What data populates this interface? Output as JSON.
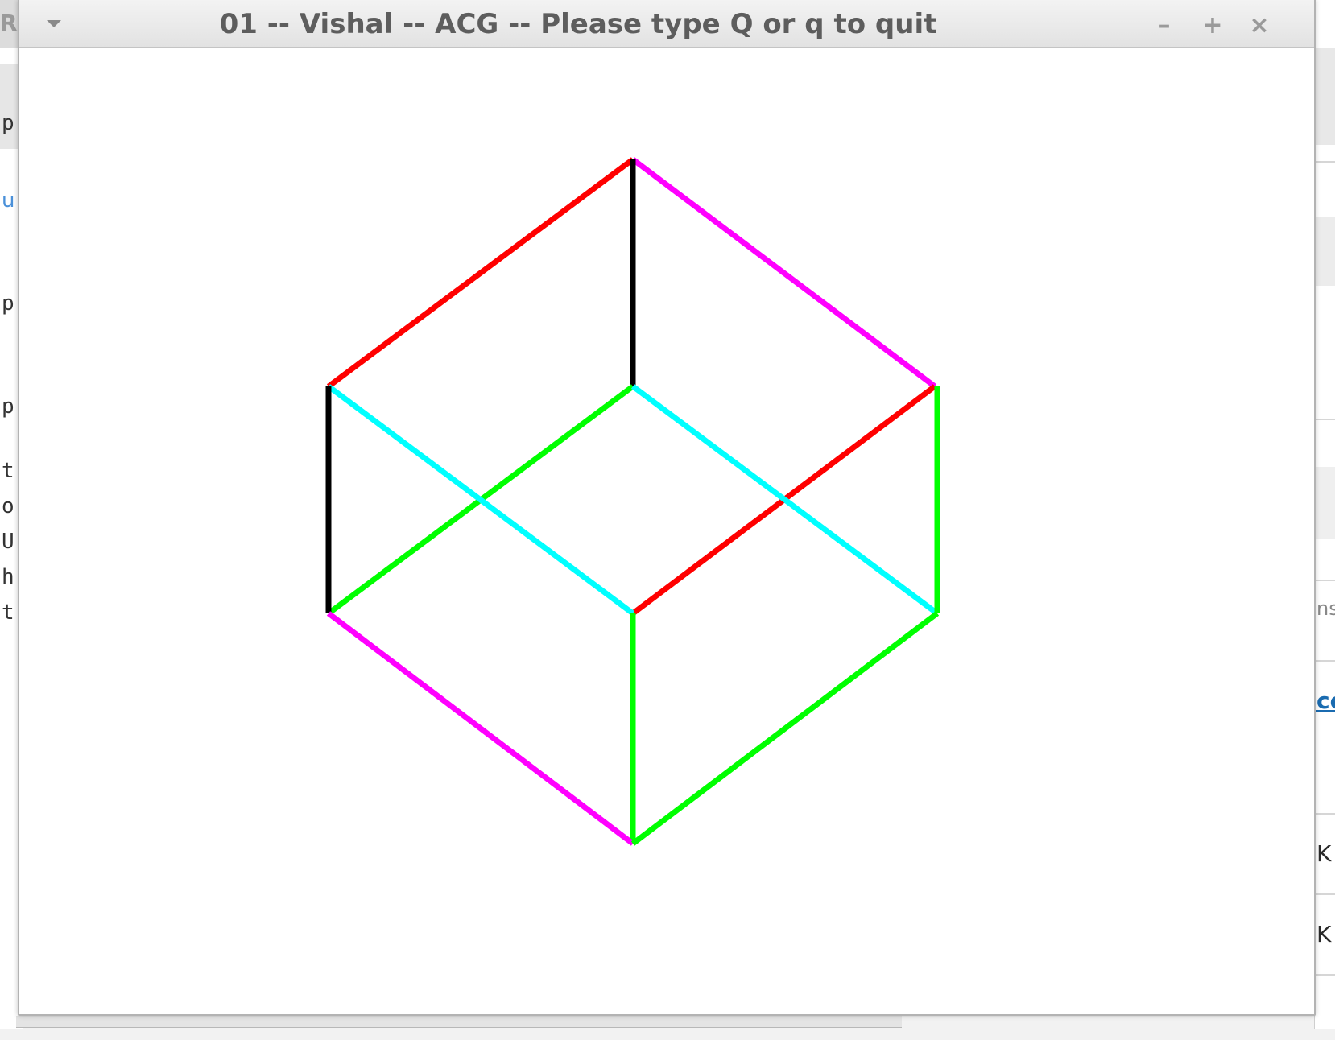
{
  "window": {
    "title": "01 -- Vishal -- ACG -- Please type Q or q to quit",
    "controls": {
      "minimize": "–",
      "maximize": "+",
      "close": "×"
    }
  },
  "background_app": {
    "left_fragments": [
      "RA",
      "p",
      "u",
      "p",
      "p",
      "t",
      "o",
      "U",
      "h",
      "t"
    ],
    "right_fragments": [
      "ns",
      "ce",
      "K",
      "K"
    ]
  },
  "scene": {
    "description_colors": {
      "red": "#ff0000",
      "magenta": "#ff00ff",
      "black": "#000000",
      "cyan": "#00ffff",
      "green": "#00ff00"
    }
  }
}
